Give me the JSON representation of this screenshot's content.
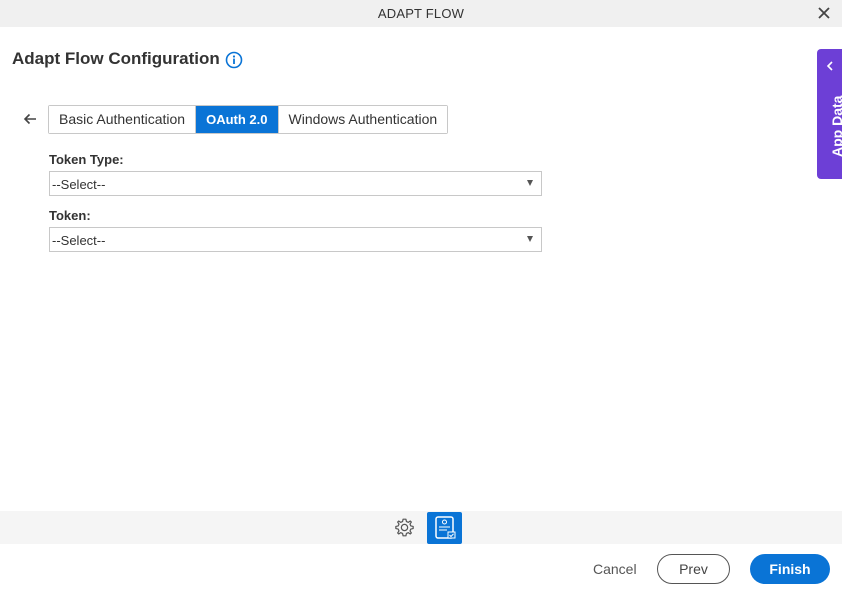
{
  "window": {
    "title": "ADAPT FLOW"
  },
  "page": {
    "title": "Adapt Flow Configuration"
  },
  "side_panel": {
    "label": "App Data"
  },
  "tabs": [
    {
      "label": "Basic Authentication",
      "active": false
    },
    {
      "label": "OAuth 2.0",
      "active": true
    },
    {
      "label": "Windows Authentication",
      "active": false
    }
  ],
  "form": {
    "token_type": {
      "label": "Token Type:",
      "value": "--Select--"
    },
    "token": {
      "label": "Token:",
      "value": "--Select--"
    }
  },
  "footer": {
    "cancel_label": "Cancel",
    "prev_label": "Prev",
    "finish_label": "Finish"
  },
  "colors": {
    "accent": "#0a74d6",
    "app_data_panel": "#6d3fd6"
  },
  "icons": {
    "close": "close-icon",
    "info": "info-icon",
    "back": "back-arrow-icon",
    "panel_toggle": "chevron-left-icon",
    "settings": "gear-icon",
    "flow": "adapt-flow-icon"
  }
}
